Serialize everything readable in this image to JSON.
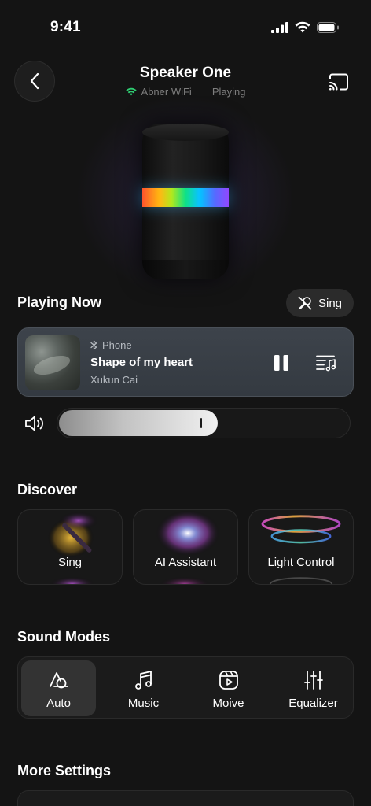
{
  "status": {
    "time": "9:41"
  },
  "header": {
    "title": "Speaker One",
    "network": "Abner WiFi",
    "state": "Playing"
  },
  "playing_now": {
    "title": "Playing Now",
    "sing_label": "Sing",
    "source": "Phone",
    "song": "Shape of my heart",
    "artist": "Xukun Cai",
    "volume_percent": 55
  },
  "discover": {
    "title": "Discover",
    "items": [
      {
        "label": "Sing"
      },
      {
        "label": "AI Assistant"
      },
      {
        "label": "Light Control"
      }
    ]
  },
  "sound_modes": {
    "title": "Sound Modes",
    "selected": "Auto",
    "items": [
      {
        "label": "Auto",
        "icon": "auto-icon"
      },
      {
        "label": "Music",
        "icon": "music-note-icon"
      },
      {
        "label": "Moive",
        "icon": "video-icon"
      },
      {
        "label": "Equalizer",
        "icon": "equalizer-icon"
      }
    ]
  },
  "more_settings": {
    "title": "More Settings"
  },
  "colors": {
    "background": "#141414",
    "card": "#1b1b1b",
    "now_playing_card": "#3a4047",
    "wifi_green": "#2ecc71"
  }
}
